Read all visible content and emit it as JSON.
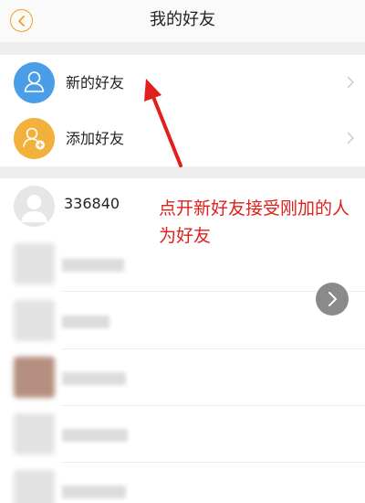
{
  "header": {
    "title": "我的好友",
    "back_icon": "chevron-left-icon",
    "accent_color": "#f0a021"
  },
  "menu": {
    "items": [
      {
        "label": "新的好友",
        "icon": "new-friend-user-icon",
        "color": "#4a9ee8"
      },
      {
        "label": "添加好友",
        "icon": "add-friend-user-icon",
        "color": "#f2b13a"
      }
    ]
  },
  "friends": [
    {
      "name": "336840"
    }
  ],
  "annotation": {
    "text": "点开新好友接受刚加的人为好友",
    "color": "#e0201c"
  }
}
